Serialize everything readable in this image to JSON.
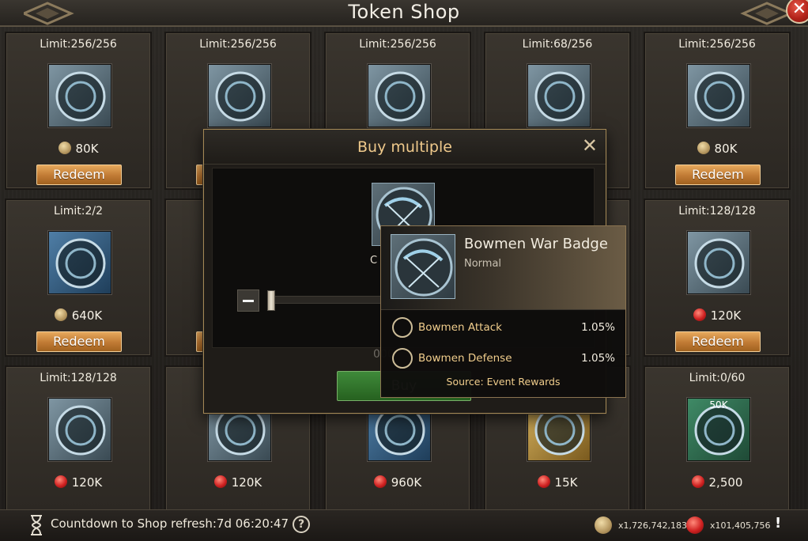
{
  "header": {
    "title": "Token Shop"
  },
  "shop": {
    "redeem_label": "Redeem",
    "cells": [
      {
        "limit": "Limit:256/256",
        "price": "80K",
        "currency": "coin",
        "icon": "infantry-shield-sword-badge-icon"
      },
      {
        "limit": "Limit:256/256",
        "price": "",
        "currency": "",
        "icon": "tower-badge-icon"
      },
      {
        "limit": "Limit:256/256",
        "price": "",
        "currency": "",
        "icon": "cavalry-horse-badge-icon"
      },
      {
        "limit": "Limit:68/256",
        "price": "",
        "currency": "",
        "icon": "helmet-badge-icon"
      },
      {
        "limit": "Limit:256/256",
        "price": "80K",
        "currency": "coin",
        "icon": "bowmen-bow-badge-icon"
      },
      {
        "limit": "Limit:2/2",
        "price": "640K",
        "currency": "coin",
        "icon": "siege-armory-icon"
      },
      {
        "limit": "L",
        "price": "",
        "currency": "",
        "icon": "item-icon"
      },
      {
        "limit": "",
        "price": "",
        "currency": "",
        "icon": "item-icon"
      },
      {
        "limit": "",
        "price": "",
        "currency": "",
        "icon": "item-icon"
      },
      {
        "limit": "Limit:128/128",
        "price": "120K",
        "currency": "gem",
        "icon": "cavalry-horse-badge-icon"
      },
      {
        "limit": "Limit:128/128",
        "price": "120K",
        "currency": "gem",
        "icon": "helmet-badge-icon"
      },
      {
        "limit": "L",
        "price": "120K",
        "currency": "gem",
        "icon": "bowmen-bow-badge-icon"
      },
      {
        "limit": "",
        "price": "960K",
        "currency": "gem",
        "icon": "siege-armory-icon"
      },
      {
        "limit": "",
        "price": "15K",
        "currency": "gem",
        "icon": "purple-banner-icon"
      },
      {
        "limit": "Limit:0/60",
        "price": "2,500",
        "currency": "gem",
        "icon": "steel-ingot-icon",
        "badge": "50K"
      }
    ]
  },
  "dialog": {
    "title": "Buy multiple",
    "close": "✕",
    "qty_label": "C",
    "cost": "000",
    "buy_label": "Buy"
  },
  "tooltip": {
    "name": "Bowmen War Badge",
    "rarity": "Normal",
    "stats": [
      {
        "label": "Bowmen Attack",
        "value": "1.05%"
      },
      {
        "label": "Bowmen Defense",
        "value": "1.05%"
      }
    ],
    "source": "Source: Event Rewards"
  },
  "footer": {
    "countdown": "Countdown to Shop refresh:7d 06:20:47",
    "help": "?",
    "coin_amount": "x1,726,742,183",
    "gem_amount": "x101,405,756",
    "alert": "!"
  },
  "colors": {
    "accent_gold": "#efc98b",
    "redeem_orange": "#c07a34",
    "buy_green": "#3f8a3a",
    "close_red": "#b3231a"
  }
}
